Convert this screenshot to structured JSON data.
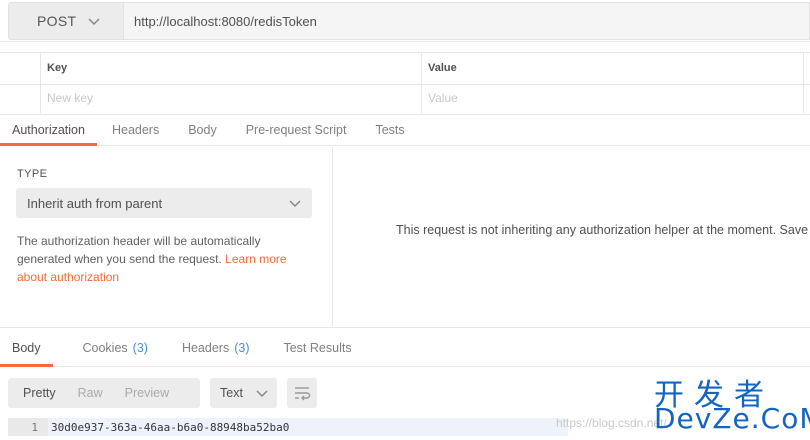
{
  "request": {
    "method": "POST",
    "url": "http://localhost:8080/redisToken"
  },
  "params": {
    "key_header": "Key",
    "value_header": "Value",
    "key_placeholder": "New key",
    "value_placeholder": "Value"
  },
  "request_tabs": [
    {
      "label": "Authorization",
      "active": true
    },
    {
      "label": "Headers"
    },
    {
      "label": "Body"
    },
    {
      "label": "Pre-request Script"
    },
    {
      "label": "Tests"
    }
  ],
  "auth": {
    "type_label": "TYPE",
    "type_value": "Inherit auth from parent",
    "description": "The authorization header will be automatically generated when you send the request.",
    "learn_more": "Learn more about authorization",
    "message": "This request is not inheriting any authorization helper at the moment. Save"
  },
  "response_tabs": [
    {
      "label": "Body",
      "active": true
    },
    {
      "label": "Cookies",
      "count": "(3)"
    },
    {
      "label": "Headers",
      "count": "(3)"
    },
    {
      "label": "Test Results"
    }
  ],
  "response_toolbar": {
    "formats": [
      "Pretty",
      "Raw",
      "Preview"
    ],
    "active_format": "Pretty",
    "language": "Text"
  },
  "response_body": {
    "line_number": "1",
    "content": "30d0e937-363a-46aa-b6a0-88948ba52ba0"
  },
  "watermark": {
    "url": "https://blog.csdn.net/",
    "chinese": "开发者",
    "brand": "DevZe.CoM"
  },
  "colors": {
    "accent": "#f26b3a",
    "link_blue": "#4a90c8",
    "watermark_blue": "#1565c0"
  }
}
